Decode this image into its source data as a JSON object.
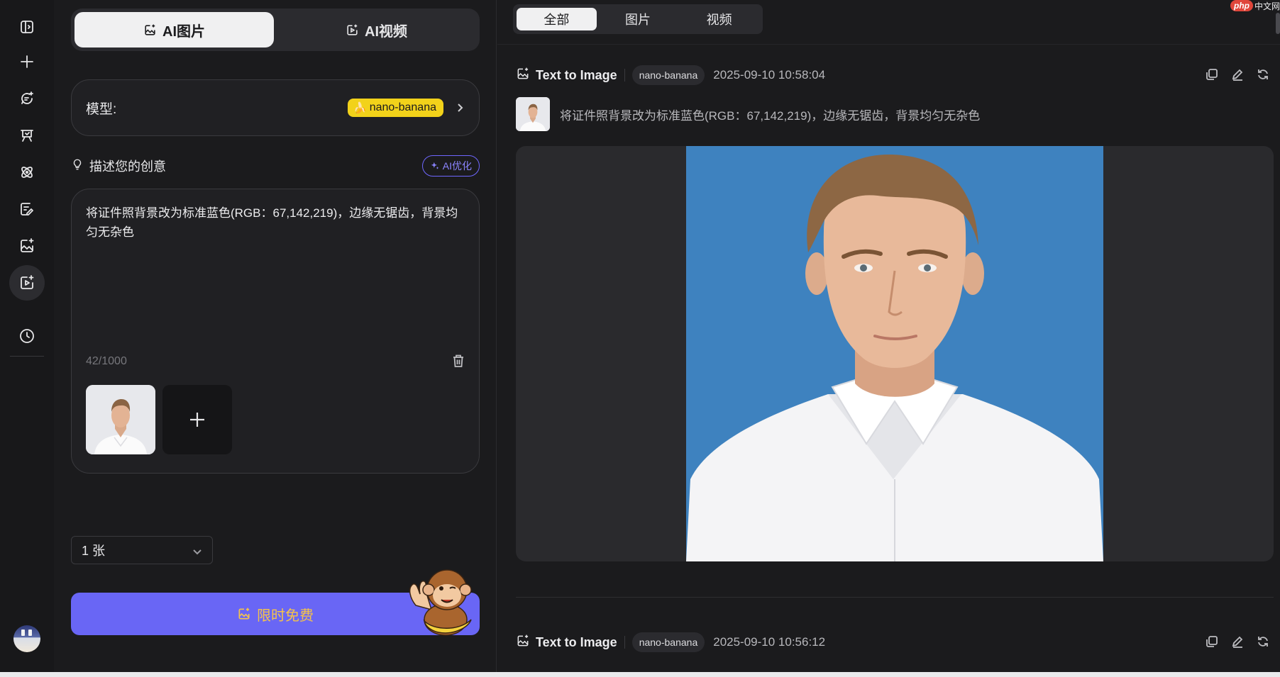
{
  "rail": {
    "items": [
      "toggle-sidebar",
      "new",
      "chat",
      "studio",
      "ai-tools",
      "edit-doc",
      "image-gen",
      "video-gen",
      "history"
    ]
  },
  "mode_tabs": [
    {
      "label": "AI图片",
      "active": true
    },
    {
      "label": "AI视频",
      "active": false
    }
  ],
  "model": {
    "label": "模型:",
    "value": "nano-banana"
  },
  "describe": {
    "title": "描述您的创意",
    "optimize_label": "AI优化",
    "prompt": "将证件照背景改为标准蓝色(RGB：67,142,219)，边缘无锯齿，背景均匀无杂色",
    "char_count": "42/1000"
  },
  "count_select": {
    "value": "1 张"
  },
  "generate": {
    "label": "限时免费"
  },
  "filter_tabs": [
    {
      "label": "全部",
      "active": true
    },
    {
      "label": "图片",
      "active": false
    },
    {
      "label": "视频",
      "active": false
    }
  ],
  "results": [
    {
      "type_label": "Text to Image",
      "model": "nano-banana",
      "timestamp": "2025-09-10 10:58:04",
      "prompt": "将证件照背景改为标准蓝色(RGB：67,142,219)，边缘无锯齿，背景均匀无杂色"
    },
    {
      "type_label": "Text to Image",
      "model": "nano-banana",
      "timestamp": "2025-09-10 10:56:12"
    }
  ],
  "watermark": {
    "brand": "php",
    "suffix": "中文网"
  },
  "colors": {
    "accent": "#6966f5",
    "badge": "#f2d21a",
    "result_background": "#3e82bf"
  }
}
